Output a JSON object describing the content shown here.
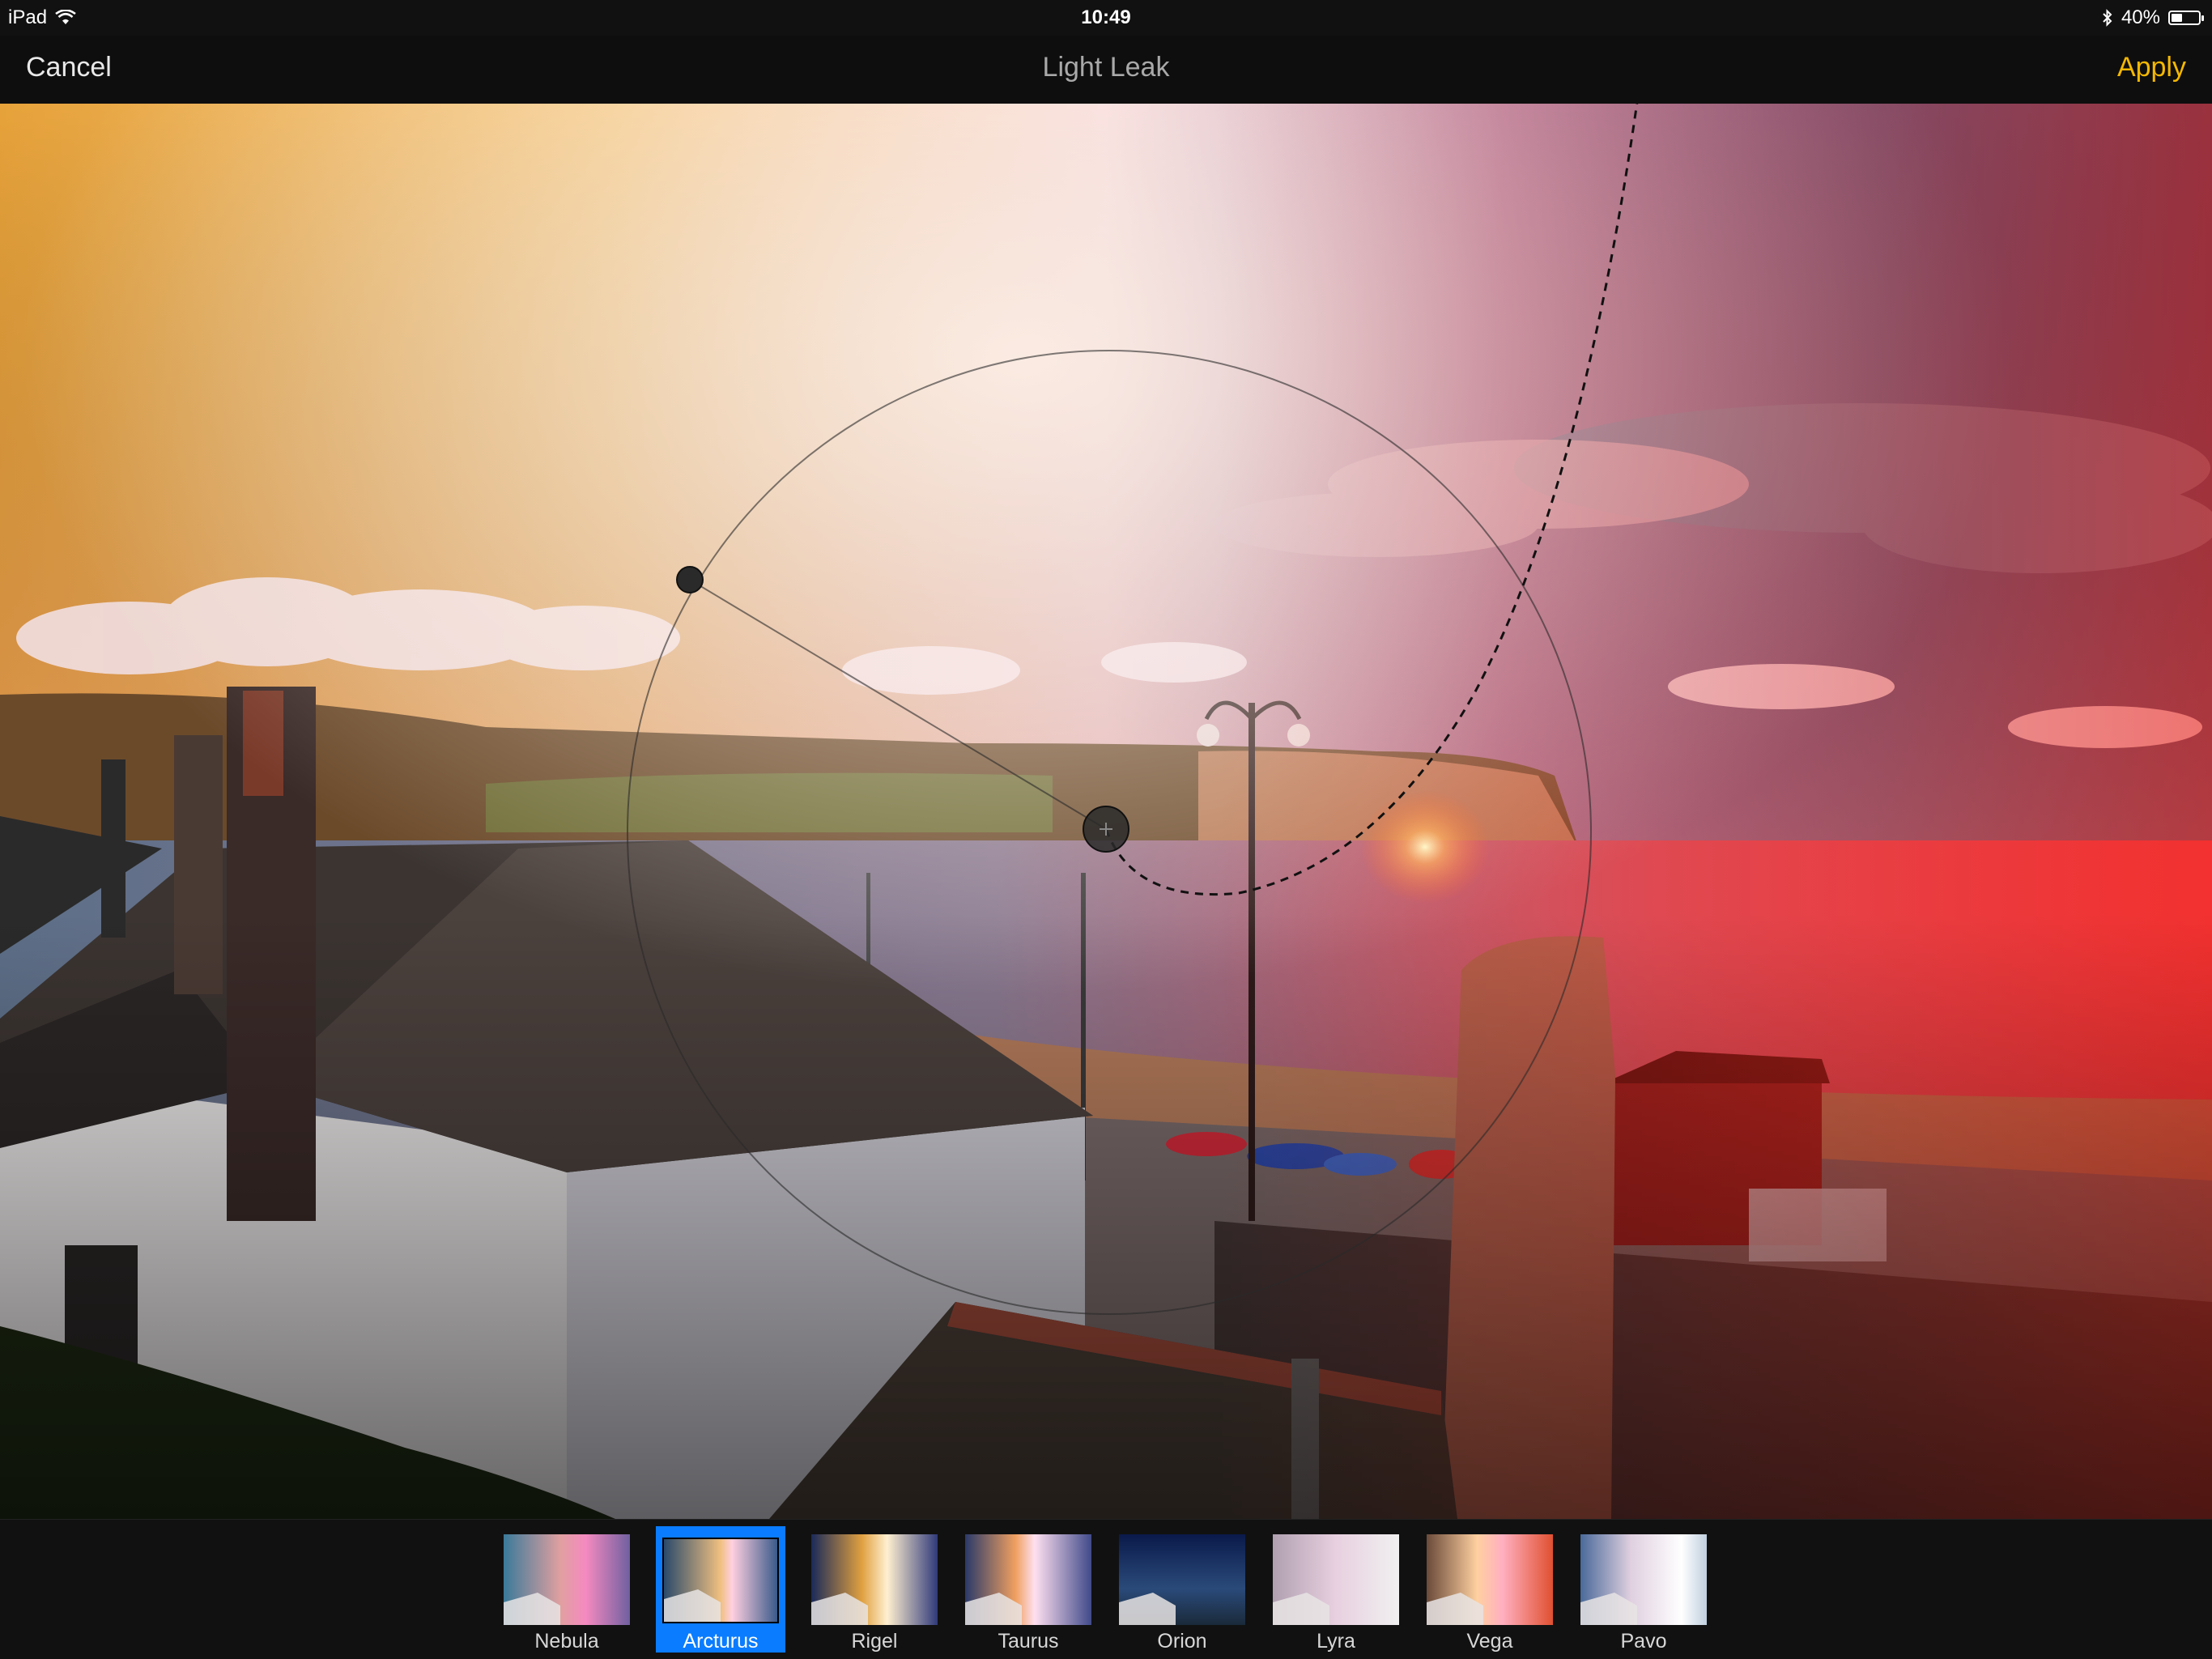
{
  "status": {
    "device": "iPad",
    "time": "10:49",
    "battery": "40%",
    "battery_level": 0.4
  },
  "nav": {
    "cancel": "Cancel",
    "title": "Light Leak",
    "apply": "Apply"
  },
  "colors": {
    "accent": "#f5b800",
    "selection": "#0a7cff"
  },
  "icons": {
    "wifi": "wifi-icon",
    "bluetooth": "bluetooth-icon",
    "battery": "battery-icon"
  },
  "filters": [
    {
      "label": "Nebula",
      "selected": false
    },
    {
      "label": "Arcturus",
      "selected": true
    },
    {
      "label": "Rigel",
      "selected": false
    },
    {
      "label": "Taurus",
      "selected": false
    },
    {
      "label": "Orion",
      "selected": false
    },
    {
      "label": "Lyra",
      "selected": false
    },
    {
      "label": "Vega",
      "selected": false
    },
    {
      "label": "Pavo",
      "selected": false
    }
  ]
}
